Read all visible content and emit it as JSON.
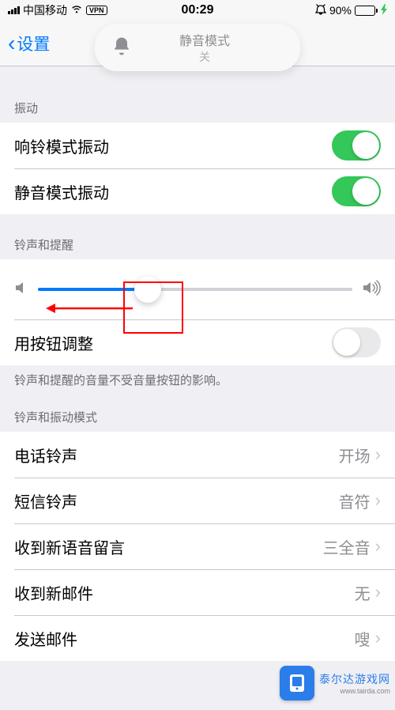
{
  "status": {
    "carrier": "中国移动",
    "vpn_badge": "VPN",
    "time": "00:29",
    "battery_pct": "90%"
  },
  "nav": {
    "back_label": "设置"
  },
  "hud": {
    "title": "静音模式",
    "subtitle": "关"
  },
  "sections": {
    "vibrate_header": "振动",
    "ring_vibrate_label": "响铃模式振动",
    "silent_vibrate_label": "静音模式振动",
    "ringer_header": "铃声和提醒",
    "change_with_buttons_label": "用按钮调整",
    "ringer_footer": "铃声和提醒的音量不受音量按钮的影响。",
    "pattern_header": "铃声和振动模式"
  },
  "rows": {
    "ringtone": {
      "label": "电话铃声",
      "value": "开场"
    },
    "texttone": {
      "label": "短信铃声",
      "value": "音符"
    },
    "voicemail": {
      "label": "收到新语音留言",
      "value": "三全音"
    },
    "newmail": {
      "label": "收到新邮件",
      "value": "无"
    },
    "sentmail": {
      "label": "发送邮件",
      "value": "嗖"
    }
  },
  "toggles": {
    "ring_vibrate": true,
    "silent_vibrate": true,
    "change_with_buttons": false
  },
  "slider": {
    "value_pct": 35
  },
  "watermark": {
    "text": "泰尔达游戏网",
    "sub": "www.tairda.com"
  }
}
